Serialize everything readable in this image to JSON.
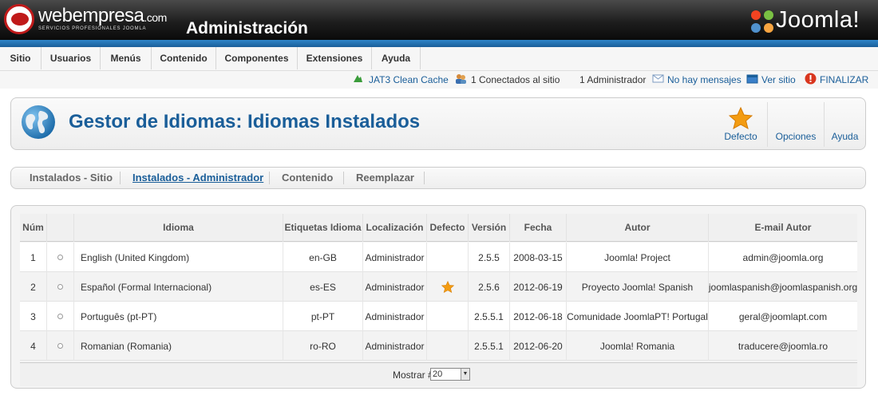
{
  "header": {
    "brand": "webempresa",
    "brand_suffix": ".com",
    "brand_tagline": "SERVICIOS PROFESIONALES JOOMLA",
    "title": "Administración",
    "joomla_brand": "Joomla!"
  },
  "menu": [
    "Sitio",
    "Usuarios",
    "Menús",
    "Contenido",
    "Componentes",
    "Extensiones",
    "Ayuda"
  ],
  "status": {
    "cache": "JAT3 Clean Cache",
    "connected": "1 Conectados al sitio",
    "admins": "1 Administrador",
    "messages": "No hay mensajes",
    "view_site": "Ver sitio",
    "logout": "FINALIZAR"
  },
  "page": {
    "title": "Gestor de Idiomas: Idiomas Instalados"
  },
  "toolbar": {
    "default_label": "Defecto",
    "options_label": "Opciones",
    "help_label": "Ayuda"
  },
  "tabs": [
    {
      "label": "Instalados - Sitio",
      "active": false
    },
    {
      "label": "Instalados - Administrador",
      "active": true
    },
    {
      "label": "Contenido",
      "active": false
    },
    {
      "label": "Reemplazar",
      "active": false
    }
  ],
  "table": {
    "headers": [
      "Núm",
      "",
      "Idioma",
      "Etiquetas Idioma",
      "Localización",
      "Defecto",
      "Versión",
      "Fecha",
      "Autor",
      "E-mail Autor"
    ],
    "rows": [
      {
        "num": "1",
        "language": "English (United Kingdom)",
        "tag": "en-GB",
        "location": "Administrador",
        "default": false,
        "version": "2.5.5",
        "date": "2008-03-15",
        "author": "Joomla! Project",
        "email": "admin@joomla.org"
      },
      {
        "num": "2",
        "language": "Español (Formal Internacional)",
        "tag": "es-ES",
        "location": "Administrador",
        "default": true,
        "version": "2.5.6",
        "date": "2012-06-19",
        "author": "Proyecto Joomla! Spanish",
        "email": "joomlaspanish@joomlaspanish.org"
      },
      {
        "num": "3",
        "language": "Português (pt-PT)",
        "tag": "pt-PT",
        "location": "Administrador",
        "default": false,
        "version": "2.5.5.1",
        "date": "2012-06-18",
        "author": "Comunidade JoomlaPT! Portugal",
        "email": "geral@joomlapt.com"
      },
      {
        "num": "4",
        "language": "Romanian (Romania)",
        "tag": "ro-RO",
        "location": "Administrador",
        "default": false,
        "version": "2.5.5.1",
        "date": "2012-06-20",
        "author": "Joomla! Romania",
        "email": "traducere@joomla.ro"
      }
    ]
  },
  "footer": {
    "show_label": "Mostrar #",
    "show_value": "20"
  },
  "colors": {
    "accent": "#1a5e99",
    "star": "#f39c12",
    "logout": "#d9361e"
  },
  "icons": [
    "globe-icon",
    "star-icon",
    "cache-icon",
    "users-icon",
    "message-icon",
    "view-site-icon",
    "logout-icon"
  ]
}
